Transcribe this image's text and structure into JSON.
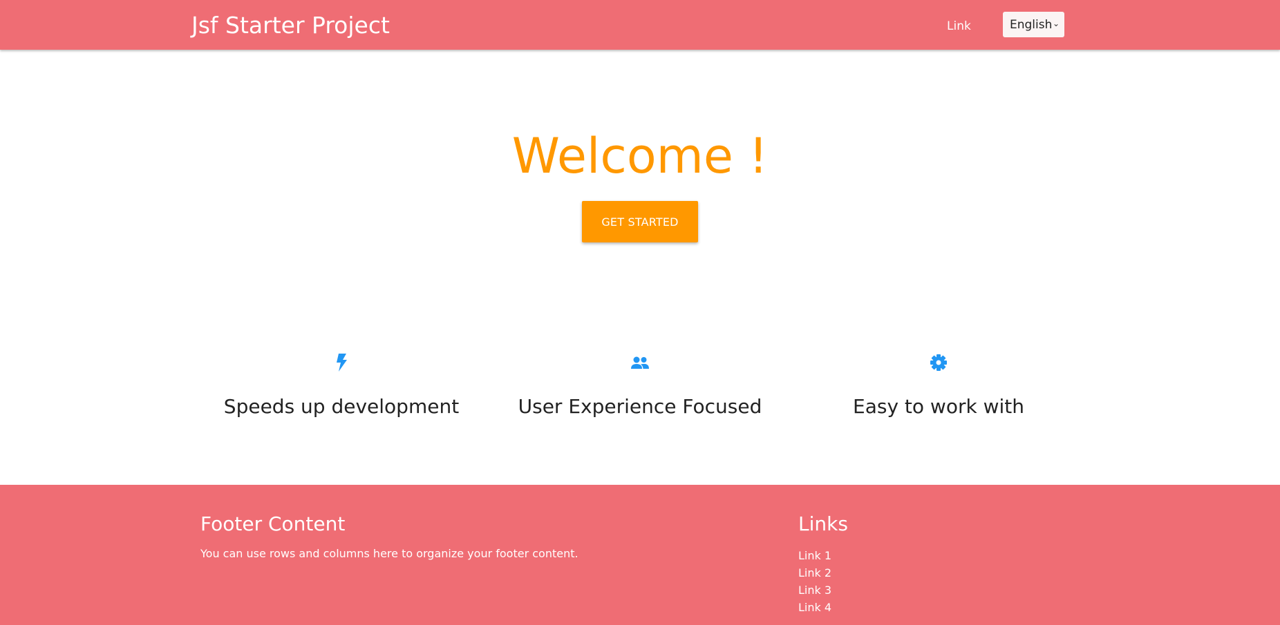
{
  "header": {
    "brand": "Jsf Starter Project",
    "link": "Link",
    "language": "English"
  },
  "hero": {
    "title": "Welcome !",
    "cta": "GET STARTED"
  },
  "features": [
    {
      "icon": "flash-icon",
      "title": "Speeds up development"
    },
    {
      "icon": "group-icon",
      "title": "User Experience Focused"
    },
    {
      "icon": "gear-icon",
      "title": "Easy to work with"
    }
  ],
  "footer": {
    "title": "Footer Content",
    "text": "You can use rows and columns here to organize your footer content.",
    "links_title": "Links",
    "links": [
      "Link 1",
      "Link 2",
      "Link 3",
      "Link 4"
    ]
  },
  "colors": {
    "primary": "#ef6d74",
    "accent": "#ff9800",
    "icon": "#2196f3"
  }
}
